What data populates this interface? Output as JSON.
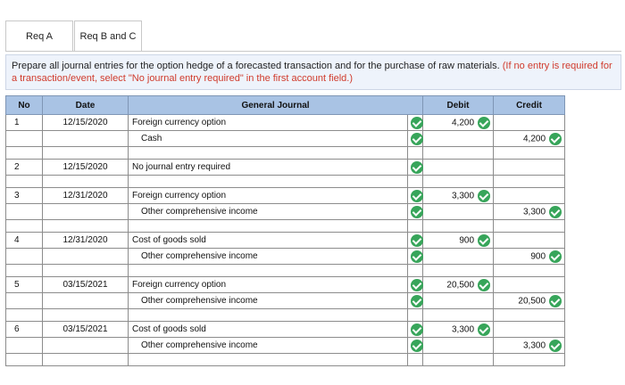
{
  "tabs": [
    {
      "label": "Req A",
      "active": true
    },
    {
      "label": "Req B and C",
      "active": false
    }
  ],
  "instructions": {
    "text": "Prepare all journal entries for the option hedge of a forecasted transaction and for the purchase of raw materials. ",
    "hint": "(If no entry is required for a transaction/event, select \"No journal entry required\" in the first account field.)"
  },
  "table": {
    "headers": {
      "no": "No",
      "date": "Date",
      "journal": "General Journal",
      "debit": "Debit",
      "credit": "Credit"
    },
    "entries": [
      {
        "no": "1",
        "date": "12/15/2020",
        "debit_account": "Foreign currency option",
        "debit": "4,200",
        "credit_account": "Cash",
        "credit": "4,200"
      },
      {
        "no": "2",
        "date": "12/15/2020",
        "debit_account": "No journal entry required",
        "debit": "",
        "credit_account": null,
        "credit": ""
      },
      {
        "no": "3",
        "date": "12/31/2020",
        "debit_account": "Foreign currency option",
        "debit": "3,300",
        "credit_account": "Other comprehensive income",
        "credit": "3,300"
      },
      {
        "no": "4",
        "date": "12/31/2020",
        "debit_account": "Cost of goods sold",
        "debit": "900",
        "credit_account": "Other comprehensive income",
        "credit": "900"
      },
      {
        "no": "5",
        "date": "03/15/2021",
        "debit_account": "Foreign currency option",
        "debit": "20,500",
        "credit_account": "Other comprehensive income",
        "credit": "20,500"
      },
      {
        "no": "6",
        "date": "03/15/2021",
        "debit_account": "Cost of goods sold",
        "debit": "3,300",
        "credit_account": "Other comprehensive income",
        "credit": "3,300"
      }
    ]
  },
  "colors": {
    "header_bg": "#a9c3e4",
    "check_green": "#37a55a",
    "hint_red": "#d03b2c",
    "instr_bg": "#eef3fb"
  },
  "icons": {
    "check": "check-circle-icon"
  }
}
